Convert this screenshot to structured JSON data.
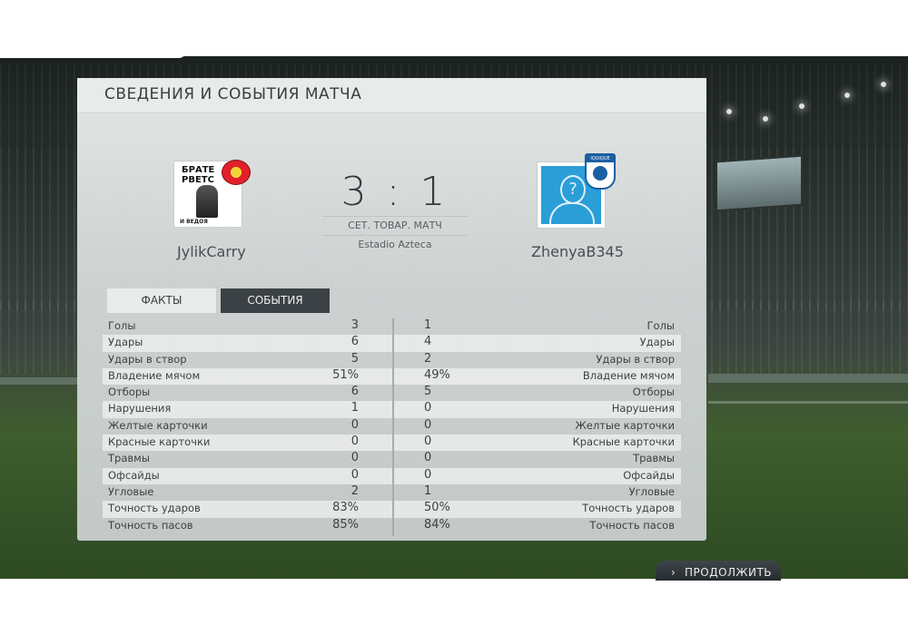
{
  "panel": {
    "title": "СВЕДЕНИЯ И СОБЫТИЯ МАТЧА"
  },
  "match": {
    "home_name": "JylikCarry",
    "away_name": "ZhenyaB345",
    "home_crest_text": "БРАТЕ\nРВЕТС",
    "home_crest_bottom": "И ВЕДОЯ",
    "away_crest_text": "IQUIQUE",
    "score": "3 : 1",
    "match_type": "СЕТ. ТОВАР. МАТЧ",
    "stadium": "Estadio Azteca"
  },
  "tabs": {
    "facts": "ФАКТЫ",
    "events": "СОБЫТИЯ"
  },
  "stats": [
    {
      "label": "Голы",
      "home": "3",
      "away": "1"
    },
    {
      "label": "Удары",
      "home": "6",
      "away": "4"
    },
    {
      "label": "Удары в створ",
      "home": "5",
      "away": "2"
    },
    {
      "label": "Владение мячом",
      "home": "51%",
      "away": "49%"
    },
    {
      "label": "Отборы",
      "home": "6",
      "away": "5"
    },
    {
      "label": "Нарушения",
      "home": "1",
      "away": "0"
    },
    {
      "label": "Желтые карточки",
      "home": "0",
      "away": "0"
    },
    {
      "label": "Красные карточки",
      "home": "0",
      "away": "0"
    },
    {
      "label": "Травмы",
      "home": "0",
      "away": "0"
    },
    {
      "label": "Офсайды",
      "home": "0",
      "away": "0"
    },
    {
      "label": "Угловые",
      "home": "2",
      "away": "1"
    },
    {
      "label": "Точность ударов",
      "home": "83%",
      "away": "50%"
    },
    {
      "label": "Точность пасов",
      "home": "85%",
      "away": "84%"
    }
  ],
  "footer": {
    "continue_chevron": "›",
    "continue_label": "ПРОДОЛЖИТЬ"
  },
  "colors": {
    "tab_active_bg": "#e9ebeb",
    "tab_inactive_bg": "#3b4145",
    "away_avatar_blue": "#2b9ed8"
  },
  "icons": [
    "avatar-placeholder-icon",
    "home-club-crest",
    "away-club-crest",
    "chevron-right-icon"
  ]
}
